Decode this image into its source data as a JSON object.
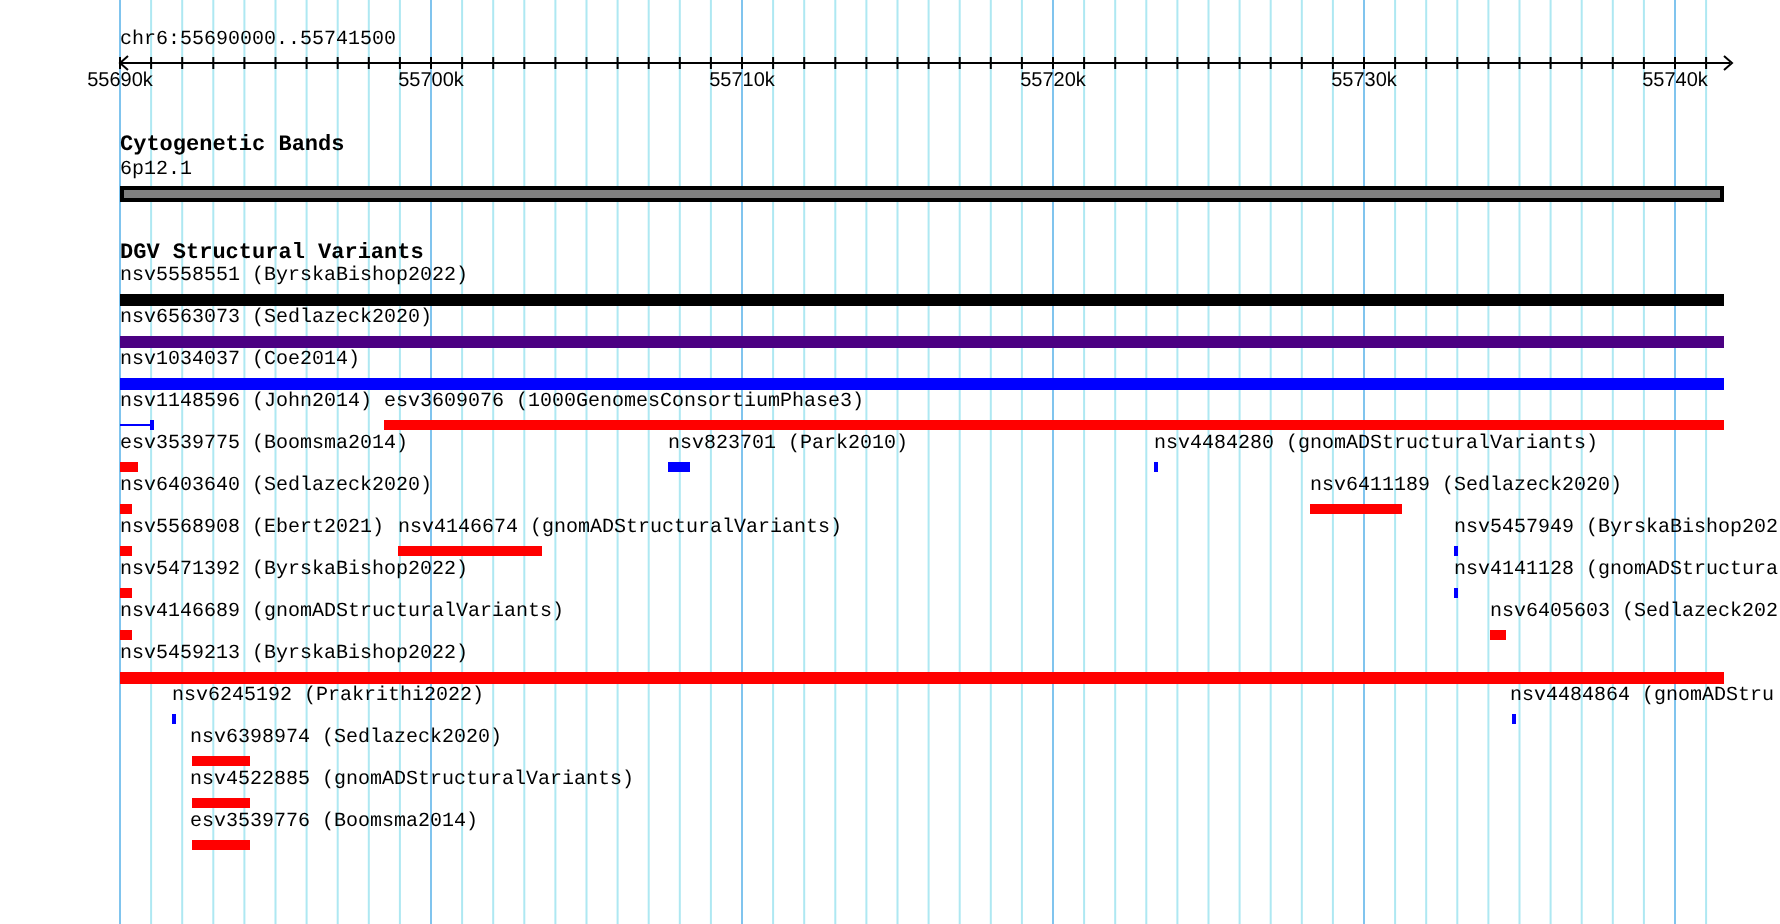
{
  "ruler": {
    "location": "chr6:55690000..55741500",
    "tick_labels": [
      "55690k",
      "55700k",
      "55710k",
      "55720k",
      "55730k",
      "55740k"
    ]
  },
  "tracks": [
    {
      "title": "Cytogenetic Bands",
      "features": [
        {
          "label": "6p12.1",
          "color": "#808080",
          "kind": "band"
        }
      ]
    },
    {
      "title": "DGV Structural Variants",
      "features": [
        {
          "label": "nsv5558551 (ByrskaBishop2022)",
          "color": "#000000",
          "kind": "box"
        },
        {
          "label": "nsv6563073 (Sedlazeck2020)",
          "color": "#4b0082",
          "kind": "box"
        },
        {
          "label": "nsv1034037 (Coe2014)",
          "color": "#0000ff",
          "kind": "box"
        },
        {
          "label": "nsv1148596 (John2014)",
          "color": "#0000ff",
          "kind": "line"
        },
        {
          "label": "esv3609076 (1000GenomesConsortiumPhase3)",
          "color": "#ff0000",
          "kind": "box"
        },
        {
          "label": "esv3539775 (Boomsma2014)",
          "color": "#ff0000",
          "kind": "box"
        },
        {
          "label": "nsv823701 (Park2010)",
          "color": "#0000ff",
          "kind": "box"
        },
        {
          "label": "nsv4484280 (gnomADStructuralVariants)",
          "color": "#0000ff",
          "kind": "box"
        },
        {
          "label": "nsv6403640 (Sedlazeck2020)",
          "color": "#ff0000",
          "kind": "box"
        },
        {
          "label": "nsv6411189 (Sedlazeck2020)",
          "color": "#ff0000",
          "kind": "box"
        },
        {
          "label": "nsv5568908 (Ebert2021)",
          "color": "#ff0000",
          "kind": "box"
        },
        {
          "label": "nsv4146674 (gnomADStructuralVariants)",
          "color": "#ff0000",
          "kind": "box"
        },
        {
          "label": "nsv5457949 (ByrskaBishop202",
          "color": "#0000ff",
          "kind": "box"
        },
        {
          "label": "nsv5471392 (ByrskaBishop2022)",
          "color": "#ff0000",
          "kind": "box"
        },
        {
          "label": "nsv4141128 (gnomADStructura",
          "color": "#0000ff",
          "kind": "box"
        },
        {
          "label": "nsv4146689 (gnomADStructuralVariants)",
          "color": "#ff0000",
          "kind": "box"
        },
        {
          "label": "nsv6405603 (Sedlazeck202",
          "color": "#ff0000",
          "kind": "box"
        },
        {
          "label": "nsv5459213 (ByrskaBishop2022)",
          "color": "#ff0000",
          "kind": "box"
        },
        {
          "label": "nsv6245192 (Prakrithi2022)",
          "color": "#0000ff",
          "kind": "box"
        },
        {
          "label": "nsv4484864 (gnomADStru",
          "color": "#0000ff",
          "kind": "box"
        },
        {
          "label": "nsv6398974 (Sedlazeck2020)",
          "color": "#ff0000",
          "kind": "box"
        },
        {
          "label": "nsv4522885 (gnomADStructuralVariants)",
          "color": "#ff0000",
          "kind": "box"
        },
        {
          "label": "esv3539776 (Boomsma2014)",
          "color": "#ff0000",
          "kind": "box"
        }
      ]
    }
  ]
}
